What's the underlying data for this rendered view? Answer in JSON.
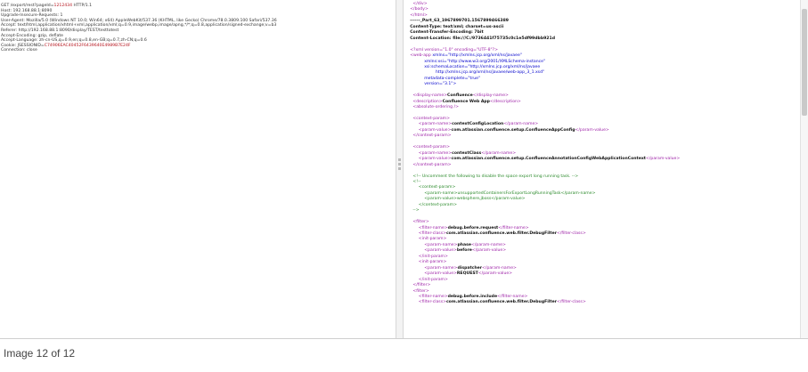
{
  "request": {
    "lines": [
      {
        "segs": [
          {
            "t": "GET /export/rest?pageId="
          },
          {
            "t": "1212434",
            "c": "hl"
          },
          {
            "t": " HTTP/1.1"
          }
        ]
      },
      {
        "segs": [
          {
            "t": "Host: 192.168.88.1:8090"
          }
        ]
      },
      {
        "segs": [
          {
            "t": "Upgrade-Insecure-Requests: 1"
          }
        ]
      },
      {
        "segs": [
          {
            "t": "User-Agent: Mozilla/5.0 (Windows NT 10.0; Win64; x64) AppleWebKit/537.36 (KHTML, like Gecko) Chrome/78.0.3809.100 Safari/537.36"
          }
        ]
      },
      {
        "segs": [
          {
            "t": "Accept: text/html,application/xhtml+xml,application/xml;q=0.9,image/webp,image/apng,*/*;q=0.8,application/signed-exchange;v=b3"
          }
        ]
      },
      {
        "segs": [
          {
            "t": "Referer: http://192.168.88.1:8090/display/TEST/testtotest"
          }
        ]
      },
      {
        "segs": [
          {
            "t": "Accept-Encoding: gzip, deflate"
          }
        ]
      },
      {
        "segs": [
          {
            "t": "Accept-Language: zh-cn-US,q=0.9,en;q=0.8,en-GB;q=0.7,zh-CN;q=0.6"
          }
        ]
      },
      {
        "segs": [
          {
            "t": "Cookie: JSESSIONID="
          },
          {
            "t": "C74906EAC40452F6439640E4989B7E24F",
            "c": "hl"
          }
        ]
      },
      {
        "segs": [
          {
            "t": "Connection: close"
          }
        ]
      }
    ]
  },
  "response": {
    "lines": [
      {
        "i": 2,
        "segs": [
          {
            "t": "</div>",
            "c": "tag"
          }
        ]
      },
      {
        "i": 1,
        "segs": [
          {
            "t": "</body>",
            "c": "tag"
          }
        ]
      },
      {
        "i": 1,
        "segs": [
          {
            "t": "</html>",
            "c": "tag"
          }
        ]
      },
      {
        "i": 1,
        "segs": [
          {
            "t": "------_Part_63_1967899701.1567899466389",
            "c": "bold"
          }
        ]
      },
      {
        "i": 1,
        "segs": [
          {
            "t": "Content-Type: text/xml; charset=us-ascii",
            "c": "bold"
          }
        ]
      },
      {
        "i": 1,
        "segs": [
          {
            "t": "Content-Transfer-Encoding: 7bit",
            "c": "bold"
          }
        ]
      },
      {
        "i": 1,
        "segs": [
          {
            "t": "Content-Location: file:///C:/9736441f75735c0c1e5df99dbb921d",
            "c": "bold"
          }
        ]
      },
      {
        "i": 1,
        "segs": [
          {
            "t": ""
          }
        ]
      },
      {
        "i": 1,
        "segs": [
          {
            "t": "<?xml version=\"1.0\" encoding=\"UTF-8\"?>",
            "c": "tag"
          }
        ]
      },
      {
        "i": 1,
        "segs": [
          {
            "t": "<web-app ",
            "c": "tag"
          },
          {
            "t": "xmlns=\"http://xmlns.jcp.org/xml/ns/javaee\"",
            "c": "attr"
          }
        ]
      },
      {
        "i": 6,
        "segs": [
          {
            "t": "xmlns:xsi=\"http://www.w3.org/2001/XMLSchema-instance\"",
            "c": "attr"
          }
        ]
      },
      {
        "i": 6,
        "segs": [
          {
            "t": "xsi:schemaLocation=\"http://xmlns.jcp.org/xml/ns/javaee",
            "c": "attr"
          }
        ]
      },
      {
        "i": 10,
        "segs": [
          {
            "t": "http://xmlns.jcp.org/xml/ns/javaee/web-app_3_1.xsd\"",
            "c": "attr"
          }
        ]
      },
      {
        "i": 6,
        "segs": [
          {
            "t": "metadata-complete=\"true\"",
            "c": "attr"
          }
        ]
      },
      {
        "i": 6,
        "segs": [
          {
            "t": "version=\"3.1\">",
            "c": "attr"
          }
        ]
      },
      {
        "i": 1,
        "segs": [
          {
            "t": ""
          }
        ]
      },
      {
        "i": 2,
        "segs": [
          {
            "t": "<display-name>",
            "c": "tag"
          },
          {
            "t": "Confluence",
            "c": "txt"
          },
          {
            "t": "</display-name>",
            "c": "tag"
          }
        ]
      },
      {
        "i": 2,
        "segs": [
          {
            "t": "<description>",
            "c": "tag"
          },
          {
            "t": "Confluence Web App",
            "c": "txt"
          },
          {
            "t": "</description>",
            "c": "tag"
          }
        ]
      },
      {
        "i": 2,
        "segs": [
          {
            "t": "<absolute-ordering />",
            "c": "tag"
          }
        ]
      },
      {
        "i": 1,
        "segs": [
          {
            "t": ""
          }
        ]
      },
      {
        "i": 2,
        "segs": [
          {
            "t": "<context-param>",
            "c": "tag"
          }
        ]
      },
      {
        "i": 4,
        "segs": [
          {
            "t": "<param-name>",
            "c": "tag"
          },
          {
            "t": "contextConfigLocation",
            "c": "txt"
          },
          {
            "t": "</param-name>",
            "c": "tag"
          }
        ]
      },
      {
        "i": 4,
        "segs": [
          {
            "t": "<param-value>",
            "c": "tag"
          },
          {
            "t": "com.atlassian.confluence.setup.ConfluenceAppConfig",
            "c": "txt"
          },
          {
            "t": "</param-value>",
            "c": "tag"
          }
        ]
      },
      {
        "i": 2,
        "segs": [
          {
            "t": "</context-param>",
            "c": "tag"
          }
        ]
      },
      {
        "i": 1,
        "segs": [
          {
            "t": ""
          }
        ]
      },
      {
        "i": 2,
        "segs": [
          {
            "t": "<context-param>",
            "c": "tag"
          }
        ]
      },
      {
        "i": 4,
        "segs": [
          {
            "t": "<param-name>",
            "c": "tag"
          },
          {
            "t": "contextClass",
            "c": "txt"
          },
          {
            "t": "</param-name>",
            "c": "tag"
          }
        ]
      },
      {
        "i": 4,
        "segs": [
          {
            "t": "<param-value>",
            "c": "tag"
          },
          {
            "t": "com.atlassian.confluence.setup.ConfluenceAnnotationConfigWebApplicationContext",
            "c": "txt"
          },
          {
            "t": "</param-value>",
            "c": "tag"
          }
        ]
      },
      {
        "i": 2,
        "segs": [
          {
            "t": "</context-param>",
            "c": "tag"
          }
        ]
      },
      {
        "i": 1,
        "segs": [
          {
            "t": ""
          }
        ]
      },
      {
        "i": 2,
        "segs": [
          {
            "t": "<!-- Uncomment the following to disable the space export long running task. -->",
            "c": "com"
          }
        ]
      },
      {
        "i": 2,
        "segs": [
          {
            "t": "<!--",
            "c": "com"
          }
        ]
      },
      {
        "i": 4,
        "segs": [
          {
            "t": "<context-param>",
            "c": "com"
          }
        ]
      },
      {
        "i": 6,
        "segs": [
          {
            "t": "<param-name>unsupportedContainersForExportLongRunningTask</param-name>",
            "c": "com"
          }
        ]
      },
      {
        "i": 6,
        "segs": [
          {
            "t": "<param-value>websphere,jboss</param-value>",
            "c": "com"
          }
        ]
      },
      {
        "i": 4,
        "segs": [
          {
            "t": "</context-param>",
            "c": "com"
          }
        ]
      },
      {
        "i": 2,
        "segs": [
          {
            "t": "-->",
            "c": "com"
          }
        ]
      },
      {
        "i": 1,
        "segs": [
          {
            "t": ""
          }
        ]
      },
      {
        "i": 2,
        "segs": [
          {
            "t": "<filter>",
            "c": "tag"
          }
        ]
      },
      {
        "i": 4,
        "segs": [
          {
            "t": "<filter-name>",
            "c": "tag"
          },
          {
            "t": "debug.before.request",
            "c": "txt"
          },
          {
            "t": "</filter-name>",
            "c": "tag"
          }
        ]
      },
      {
        "i": 4,
        "segs": [
          {
            "t": "<filter-class>",
            "c": "tag"
          },
          {
            "t": "com.atlassian.confluence.web.filter.DebugFilter",
            "c": "txt"
          },
          {
            "t": "</filter-class>",
            "c": "tag"
          }
        ]
      },
      {
        "i": 4,
        "segs": [
          {
            "t": "<init-param>",
            "c": "tag"
          }
        ]
      },
      {
        "i": 6,
        "segs": [
          {
            "t": "<param-name>",
            "c": "tag"
          },
          {
            "t": "phase",
            "c": "txt"
          },
          {
            "t": "</param-name>",
            "c": "tag"
          }
        ]
      },
      {
        "i": 6,
        "segs": [
          {
            "t": "<param-value>",
            "c": "tag"
          },
          {
            "t": "before",
            "c": "txt"
          },
          {
            "t": "</param-value>",
            "c": "tag"
          }
        ]
      },
      {
        "i": 4,
        "segs": [
          {
            "t": "</init-param>",
            "c": "tag"
          }
        ]
      },
      {
        "i": 4,
        "segs": [
          {
            "t": "<init-param>",
            "c": "tag"
          }
        ]
      },
      {
        "i": 6,
        "segs": [
          {
            "t": "<param-name>",
            "c": "tag"
          },
          {
            "t": "dispatcher",
            "c": "txt"
          },
          {
            "t": "</param-name>",
            "c": "tag"
          }
        ]
      },
      {
        "i": 6,
        "segs": [
          {
            "t": "<param-value>",
            "c": "tag"
          },
          {
            "t": "REQUEST",
            "c": "txt"
          },
          {
            "t": "</param-value>",
            "c": "tag"
          }
        ]
      },
      {
        "i": 4,
        "segs": [
          {
            "t": "</init-param>",
            "c": "tag"
          }
        ]
      },
      {
        "i": 2,
        "segs": [
          {
            "t": "</filter>",
            "c": "tag"
          }
        ]
      },
      {
        "i": 2,
        "segs": [
          {
            "t": "<filter>",
            "c": "tag"
          }
        ]
      },
      {
        "i": 4,
        "segs": [
          {
            "t": "<filter-name>",
            "c": "tag"
          },
          {
            "t": "debug.before.include",
            "c": "txt"
          },
          {
            "t": "</filter-name>",
            "c": "tag"
          }
        ]
      },
      {
        "i": 4,
        "segs": [
          {
            "t": "<filter-class>",
            "c": "tag"
          },
          {
            "t": "com.atlassian.confluence.web.filter.DebugFilter",
            "c": "txt"
          },
          {
            "t": "</filter-class>",
            "c": "tag"
          }
        ]
      }
    ]
  },
  "caption": "Image 12 of 12"
}
